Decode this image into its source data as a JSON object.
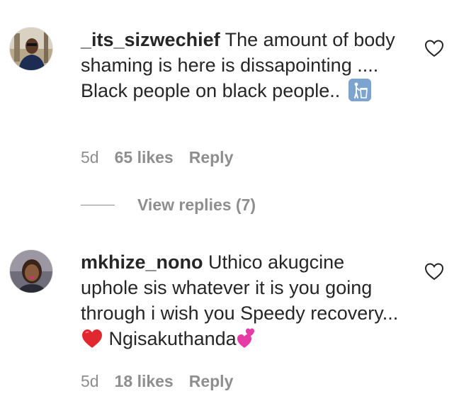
{
  "comments": [
    {
      "username": "_its_sizwechief",
      "text": "The amount of body shaming is here is dissapointing .... Black people on black people..",
      "emoji": "litter-in-bin-icon",
      "time": "5d",
      "likes": "65 likes",
      "reply": "Reply",
      "view_replies": "View replies (7)"
    },
    {
      "username": "mkhize_nono",
      "text_before_heart": "Uthico akugcine uphole sis whatever it is you going through i wish you Speedy recovery...",
      "text_after_heart": "Ngisakuthanda",
      "time": "5d",
      "likes": "18 likes",
      "reply": "Reply"
    }
  ],
  "colors": {
    "text": "#262626",
    "muted": "#8e8e8e",
    "heart_red": "#e0282e",
    "pink": "#e63ba6"
  }
}
